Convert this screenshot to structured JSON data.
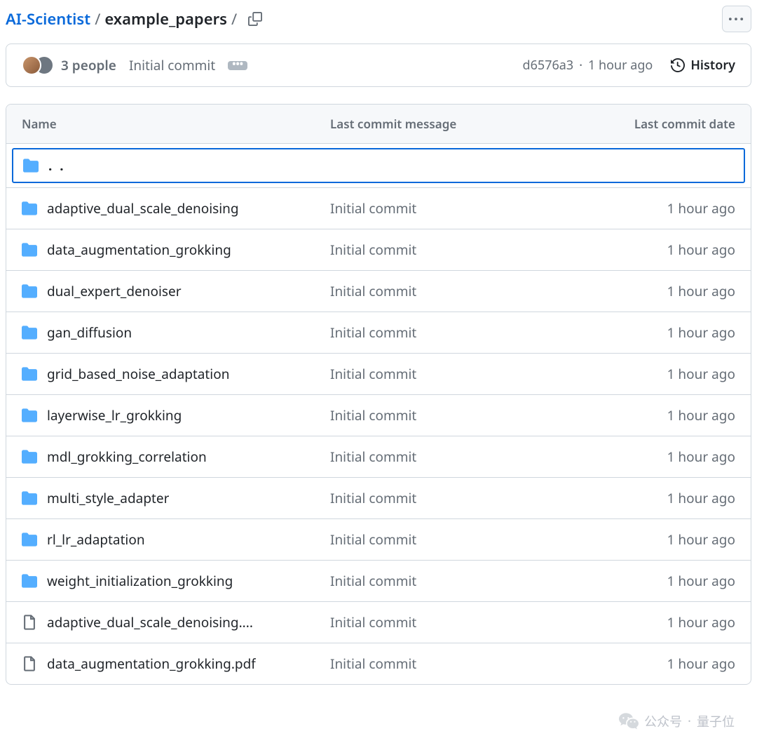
{
  "breadcrumb": {
    "repo": "AI-Scientist",
    "current": "example_papers",
    "separator": "/"
  },
  "commit_bar": {
    "people_label": "3 people",
    "message": "Initial commit",
    "more": "•••",
    "sha": "d6576a3",
    "time": "1 hour ago",
    "history_label": "History"
  },
  "table": {
    "headers": {
      "name": "Name",
      "message": "Last commit message",
      "date": "Last commit date"
    },
    "parent_label": ". .",
    "rows": [
      {
        "type": "dir",
        "name": "adaptive_dual_scale_denoising",
        "message": "Initial commit",
        "date": "1 hour ago"
      },
      {
        "type": "dir",
        "name": "data_augmentation_grokking",
        "message": "Initial commit",
        "date": "1 hour ago"
      },
      {
        "type": "dir",
        "name": "dual_expert_denoiser",
        "message": "Initial commit",
        "date": "1 hour ago"
      },
      {
        "type": "dir",
        "name": "gan_diffusion",
        "message": "Initial commit",
        "date": "1 hour ago"
      },
      {
        "type": "dir",
        "name": "grid_based_noise_adaptation",
        "message": "Initial commit",
        "date": "1 hour ago"
      },
      {
        "type": "dir",
        "name": "layerwise_lr_grokking",
        "message": "Initial commit",
        "date": "1 hour ago"
      },
      {
        "type": "dir",
        "name": "mdl_grokking_correlation",
        "message": "Initial commit",
        "date": "1 hour ago"
      },
      {
        "type": "dir",
        "name": "multi_style_adapter",
        "message": "Initial commit",
        "date": "1 hour ago"
      },
      {
        "type": "dir",
        "name": "rl_lr_adaptation",
        "message": "Initial commit",
        "date": "1 hour ago"
      },
      {
        "type": "dir",
        "name": "weight_initialization_grokking",
        "message": "Initial commit",
        "date": "1 hour ago"
      },
      {
        "type": "file",
        "name": "adaptive_dual_scale_denoising....",
        "message": "Initial commit",
        "date": "1 hour ago"
      },
      {
        "type": "file",
        "name": "data_augmentation_grokking.pdf",
        "message": "Initial commit",
        "date": "1 hour ago"
      }
    ]
  },
  "watermark": {
    "brand": "公众号",
    "author": "量子位"
  }
}
